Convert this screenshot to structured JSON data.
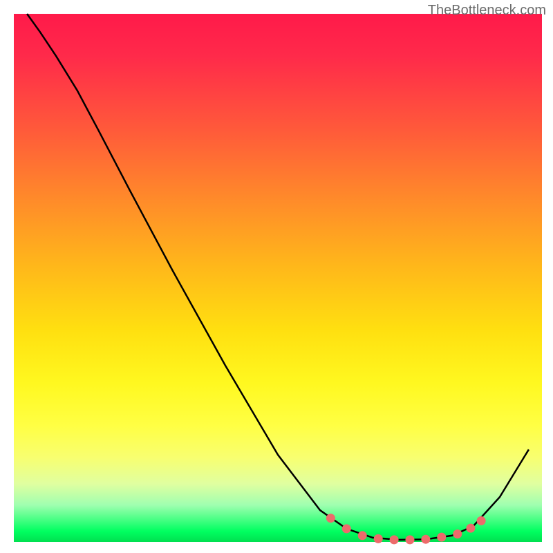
{
  "watermark": "TheBottleneck.com",
  "chart_data": {
    "type": "line",
    "title": "",
    "xlabel": "",
    "ylabel": "",
    "xlim": [
      0,
      100
    ],
    "ylim": [
      0,
      100
    ],
    "curve": [
      {
        "x": 2.5,
        "y": 100
      },
      {
        "x": 5,
        "y": 96.5
      },
      {
        "x": 8,
        "y": 92
      },
      {
        "x": 12,
        "y": 85.5
      },
      {
        "x": 16,
        "y": 78
      },
      {
        "x": 22,
        "y": 66.5
      },
      {
        "x": 30,
        "y": 51.5
      },
      {
        "x": 40,
        "y": 33.5
      },
      {
        "x": 50,
        "y": 16.5
      },
      {
        "x": 58,
        "y": 6.0
      },
      {
        "x": 63,
        "y": 2.5
      },
      {
        "x": 68,
        "y": 0.8
      },
      {
        "x": 73,
        "y": 0.4
      },
      {
        "x": 78,
        "y": 0.5
      },
      {
        "x": 83,
        "y": 1.2
      },
      {
        "x": 87,
        "y": 3.0
      },
      {
        "x": 92,
        "y": 8.5
      },
      {
        "x": 97.5,
        "y": 17.5
      }
    ],
    "markers": [
      {
        "x": 60,
        "y": 4.5
      },
      {
        "x": 63,
        "y": 2.5
      },
      {
        "x": 66,
        "y": 1.2
      },
      {
        "x": 69,
        "y": 0.6
      },
      {
        "x": 72,
        "y": 0.4
      },
      {
        "x": 75,
        "y": 0.4
      },
      {
        "x": 78,
        "y": 0.5
      },
      {
        "x": 81,
        "y": 0.9
      },
      {
        "x": 84,
        "y": 1.5
      },
      {
        "x": 86.5,
        "y": 2.6
      },
      {
        "x": 88.5,
        "y": 4.0
      }
    ],
    "gradient_stops": [
      {
        "pos": 0,
        "color": "#ff1a4a"
      },
      {
        "pos": 50,
        "color": "#ffd010"
      },
      {
        "pos": 100,
        "color": "#00e050"
      }
    ],
    "marker_color": "#ed6b6b"
  }
}
